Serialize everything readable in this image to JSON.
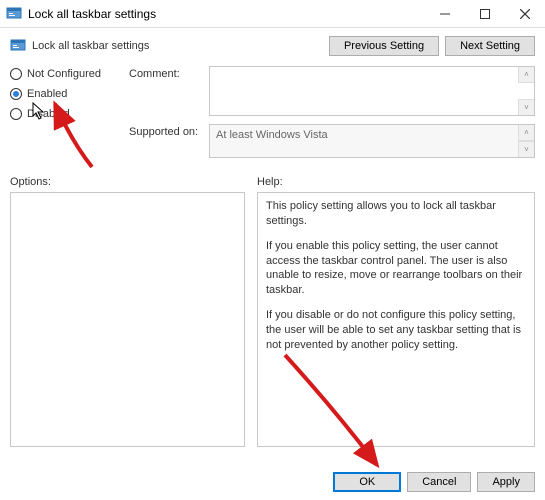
{
  "window": {
    "title": "Lock all taskbar settings"
  },
  "header": {
    "title": "Lock all taskbar settings",
    "prev_label": "Previous Setting",
    "next_label": "Next Setting"
  },
  "radios": {
    "not_configured": "Not Configured",
    "enabled": "Enabled",
    "disabled": "Disabled",
    "selected": "enabled"
  },
  "fields": {
    "comment_label": "Comment:",
    "comment_value": "",
    "supported_label": "Supported on:",
    "supported_value": "At least Windows Vista"
  },
  "sections": {
    "options_label": "Options:",
    "help_label": "Help:"
  },
  "help": {
    "p1": "This policy setting allows you to lock all taskbar settings.",
    "p2": "If you enable this policy setting, the user cannot access the taskbar control panel. The user is also unable to resize, move or rearrange toolbars on their taskbar.",
    "p3": "If you disable or do not configure this policy setting, the user will be able to set any taskbar setting that is not prevented by another policy setting."
  },
  "buttons": {
    "ok": "OK",
    "cancel": "Cancel",
    "apply": "Apply"
  },
  "annotations": {
    "arrow_color": "#d41a1a"
  }
}
